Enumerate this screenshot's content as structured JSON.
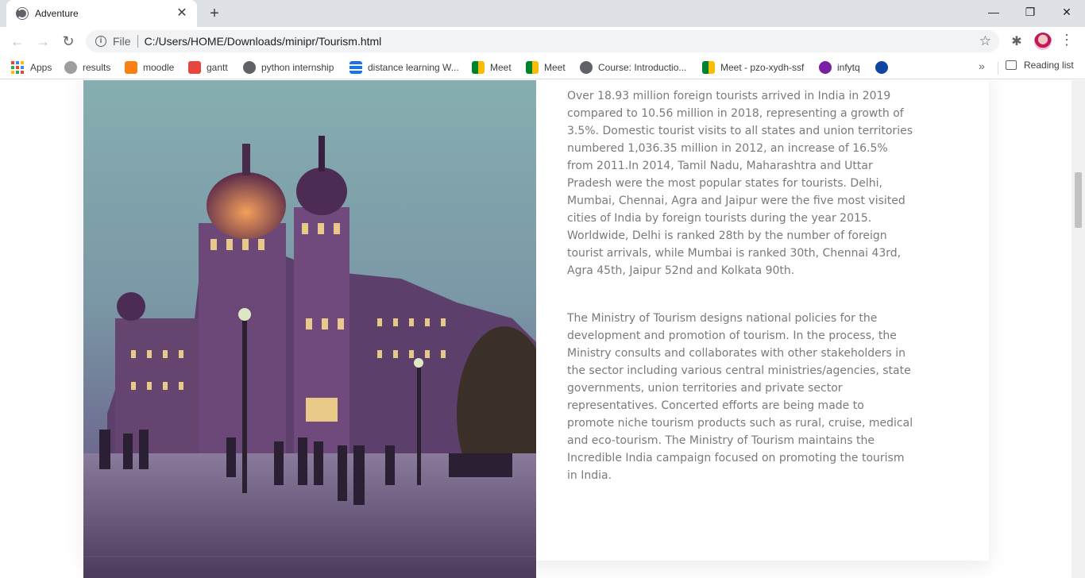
{
  "browser": {
    "tab_title": "Adventure",
    "address": {
      "scheme_label": "File",
      "url": "C:/Users/HOME/Downloads/minipr/Tourism.html"
    },
    "bookmarks": [
      {
        "label": "Apps",
        "icon": "apps-grid-icon"
      },
      {
        "label": "results",
        "icon": "results-icon"
      },
      {
        "label": "moodle",
        "icon": "moodle-icon"
      },
      {
        "label": "gantt",
        "icon": "gantt-icon"
      },
      {
        "label": "python internship",
        "icon": "globe-icon"
      },
      {
        "label": "distance learning W...",
        "icon": "distance-learning-icon"
      },
      {
        "label": "Meet",
        "icon": "meet-icon"
      },
      {
        "label": "Meet",
        "icon": "meet-icon"
      },
      {
        "label": "Course: Introductio...",
        "icon": "globe-icon"
      },
      {
        "label": "Meet - pzo-xydh-ssf",
        "icon": "meet-icon"
      },
      {
        "label": "infytq",
        "icon": "infytq-icon"
      },
      {
        "label": "",
        "icon": "bookmark-extra-icon"
      }
    ],
    "bookmarks_overflow": "»",
    "reading_list_label": "Reading list"
  },
  "page": {
    "paragraphs": [
      "Over 18.93 million foreign tourists arrived in India in 2019 compared to 10.56 million in 2018, representing a growth of 3.5%. Domestic tourist visits to all states and union territories numbered 1,036.35 million in 2012, an increase of 16.5% from 2011.In 2014, Tamil Nadu, Maharashtra and Uttar Pradesh were the most popular states for tourists. Delhi, Mumbai, Chennai, Agra and Jaipur were the five most visited cities of India by foreign tourists during the year 2015. Worldwide, Delhi is ranked 28th by the number of foreign tourist arrivals, while Mumbai is ranked 30th, Chennai 43rd, Agra 45th, Jaipur 52nd and Kolkata 90th.",
      "The Ministry of Tourism designs national policies for the development and promotion of tourism. In the process, the Ministry consults and collaborates with other stakeholders in the sector including various central ministries/agencies, state governments, union territories and private sector representatives. Concerted efforts are being made to promote niche tourism products such as rural, cruise, medical and eco-tourism. The Ministry of Tourism maintains the Incredible India campaign focused on promoting the tourism in India."
    ]
  }
}
